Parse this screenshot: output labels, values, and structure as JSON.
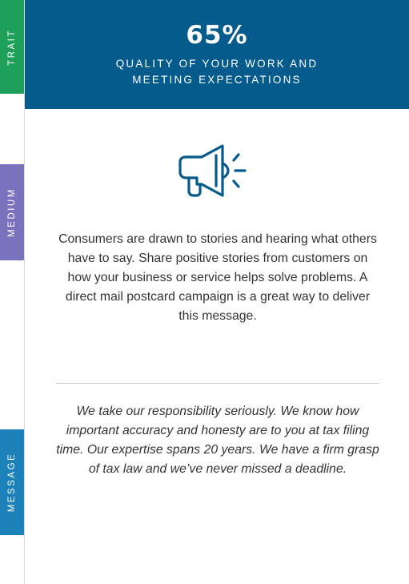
{
  "tabs": {
    "trait": "TRAIT",
    "medium": "MEDIUM",
    "message": "MESSAGE"
  },
  "header": {
    "percentage": "65%",
    "subtitle": "QUALITY OF YOUR WORK AND MEETING EXPECTATIONS"
  },
  "icon": "megaphone-icon",
  "body_text": "Consumers are drawn to stories and hearing what others have to say. Share positive stories from customers on how your business or service helps solve problems. A direct mail postcard campaign is a great way to deliver this message.",
  "message_text": "We take our responsibility seriously. We know how important accuracy and honesty are to you at tax filing time. Our expertise spans 20 years. We have a firm grasp of tax law and we’ve never missed a deadline.",
  "colors": {
    "trait_tab": "#1fa05a",
    "medium_tab": "#7a72bd",
    "message_tab": "#1c81b8",
    "header_bg": "#045b8c",
    "icon_stroke": "#045b8c"
  }
}
